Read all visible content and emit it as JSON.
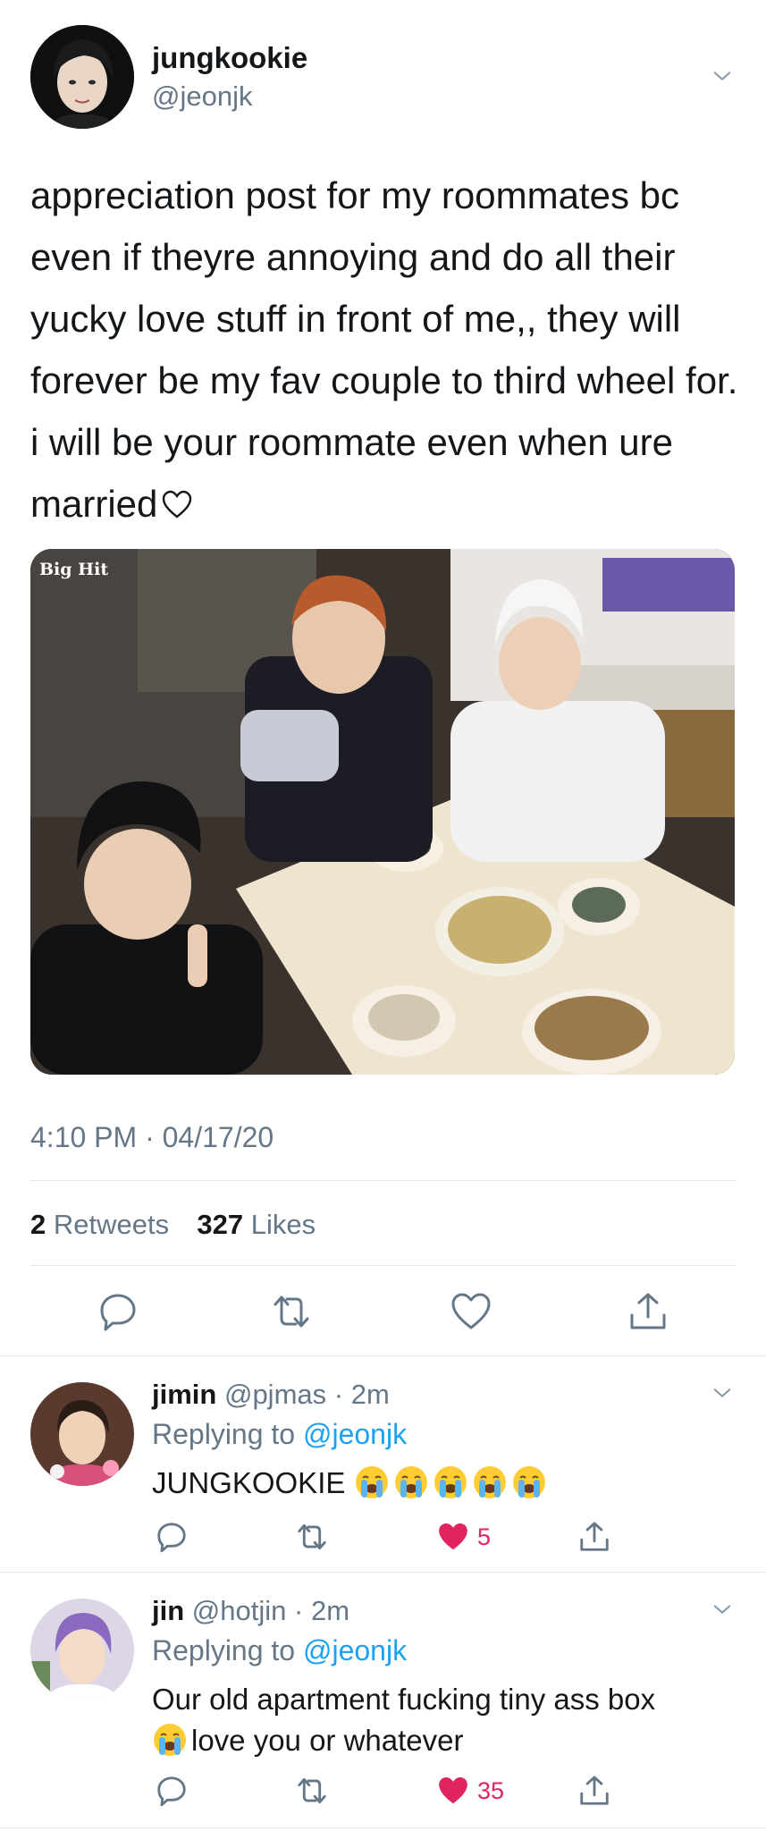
{
  "tweet": {
    "display_name": "jungkookie",
    "handle": "@jeonjk",
    "text": "appreciation post for my roommates bc even if theyre annoying and do all their yucky love stuff in front of me,, they will forever be my fav couple to third wheel for. i will be your roommate even when ure married",
    "image_logo": "Big Hit",
    "timestamp": "4:10 PM · 04/17/20",
    "retweets_count": "2",
    "retweets_label": "Retweets",
    "likes_count": "327",
    "likes_label": "Likes"
  },
  "replies": [
    {
      "name": "jimin",
      "handle": "@pjmas",
      "time": "· 2m",
      "replying_prefix": "Replying to",
      "replying_to": "@jeonjk",
      "text": "JUNGKOOKIE",
      "emoji_count": 5,
      "like_count": "5",
      "liked": true
    },
    {
      "name": "jin",
      "handle": "@hotjin",
      "time": "· 2m",
      "replying_prefix": "Replying to",
      "replying_to": "@jeonjk",
      "text_line1": "Our old apartment fucking tiny ass box",
      "text_line2": "love you or whatever",
      "like_count": "35",
      "liked": true
    }
  ],
  "colors": {
    "accent": "#1da1f2",
    "like": "#e0245e",
    "secondary_text": "#657786",
    "icon_gray": "#657786"
  }
}
